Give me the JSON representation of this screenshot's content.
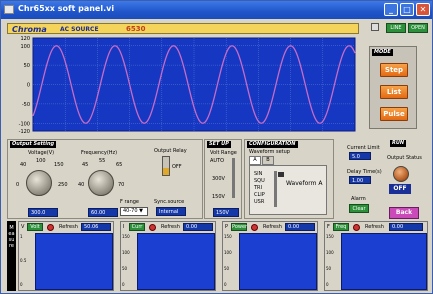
{
  "window": {
    "title": "Chr65xx soft panel.vi"
  },
  "header": {
    "brand": "Chroma",
    "subtitle": "AC SOURCE",
    "model": "6530"
  },
  "top_right": {
    "btn1": "LINE",
    "btn2": "OPEN"
  },
  "waveform": {
    "y_ticks": [
      "120",
      "100",
      "50",
      "0",
      "-50",
      "-100",
      "-120"
    ],
    "cycles": 5.5,
    "amplitude": 100,
    "line_color": "#c76bc5",
    "bg_color": "#1537c2"
  },
  "mode": {
    "label": "MODE",
    "buttons": [
      "Step",
      "List",
      "Pulse"
    ]
  },
  "output_setting": {
    "label": "Output Setting",
    "voltage_label": "Voltage(V)",
    "voltage_ticks": [
      "0",
      "20",
      "40",
      "60",
      "80",
      "100",
      "120",
      "150",
      "200",
      "250"
    ],
    "voltage_value": "300.0",
    "frequency_label": "Frequency(Hz)",
    "frequency_ticks": [
      "40",
      "45",
      "50",
      "55",
      "60",
      "65",
      "70"
    ],
    "frequency_value": "60.00",
    "f_range_label": "F range",
    "f_range_value": "40-70",
    "output_relay_label": "Output Relay",
    "output_relay_value": "OFF",
    "sync_source_label": "Sync.source",
    "sync_source_value": "Internal"
  },
  "setup": {
    "label": "SET UP",
    "volt_range_label": "Volt Range",
    "volt_range_auto": "AUTO",
    "volt_range_300": "300V",
    "volt_range_150": "150V",
    "value": "150V"
  },
  "configuration": {
    "label": "CONFIGURATION",
    "waveform_setup_label": "Waveform setup",
    "tabs": [
      "A",
      "B"
    ],
    "items": [
      "SIN",
      "SQU",
      "TRI",
      "CLIP",
      "USR"
    ],
    "waveform_a_label": "Waveform A"
  },
  "limits": {
    "current_limit_label": "Current Limit",
    "current_limit_value": "5.0",
    "delay_time_label": "Delay Time(s)",
    "delay_time_value": "1.00",
    "alarm_label": "Alarm",
    "alarm_value": "Clear",
    "run_label": "RUN",
    "output_status_label": "Output Status",
    "output_status_value": "OFF",
    "back_label": "Back"
  },
  "channels": [
    {
      "id": "V",
      "selector": "Volt",
      "refresh_label": "Refresh",
      "value": "50.06",
      "y_ticks": [
        "1",
        "0.5",
        "0"
      ]
    },
    {
      "id": "I",
      "selector": "Curr",
      "refresh_label": "Refresh",
      "value": "0.00",
      "y_ticks": [
        "150",
        "100",
        "50",
        "0"
      ]
    },
    {
      "id": "P",
      "selector": "Power",
      "refresh_label": "Refresh",
      "value": "0.00",
      "y_ticks": [
        "150",
        "100",
        "50",
        "0"
      ]
    },
    {
      "id": "F",
      "selector": "Freq",
      "refresh_label": "Refresh",
      "value": "0.00",
      "y_ticks": [
        "150",
        "100",
        "50",
        "0"
      ]
    }
  ],
  "side_letters": "Measure"
}
